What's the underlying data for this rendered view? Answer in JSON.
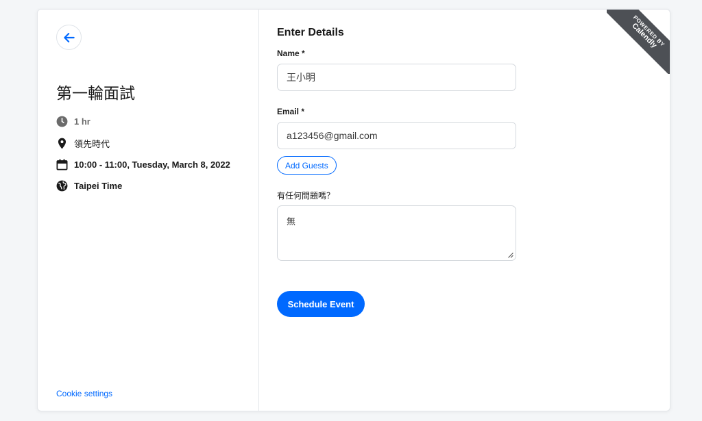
{
  "event": {
    "title": "第一輪面試",
    "duration": "1 hr",
    "location": "領先時代",
    "datetime": "10:00 - 11:00, Tuesday, March 8, 2022",
    "timezone": "Taipei Time"
  },
  "footer": {
    "cookie_settings": "Cookie settings"
  },
  "form": {
    "section_title": "Enter Details",
    "name_label": "Name *",
    "name_value": "王小明",
    "email_label": "Email *",
    "email_value": "a123456@gmail.com",
    "add_guests_label": "Add Guests",
    "question_label": "有任何問題嗎？",
    "question_value": "無",
    "submit_label": "Schedule Event"
  },
  "ribbon": {
    "line1": "POWERED BY",
    "line2": "Calendly"
  },
  "icons": {
    "back": "arrow-left-icon",
    "duration": "clock-icon",
    "location": "map-pin-icon",
    "datetime": "calendar-icon",
    "timezone": "globe-icon"
  },
  "colors": {
    "accent": "#0069ff",
    "ribbon": "#4d5055",
    "icon_gray": "#6b6b6b"
  }
}
